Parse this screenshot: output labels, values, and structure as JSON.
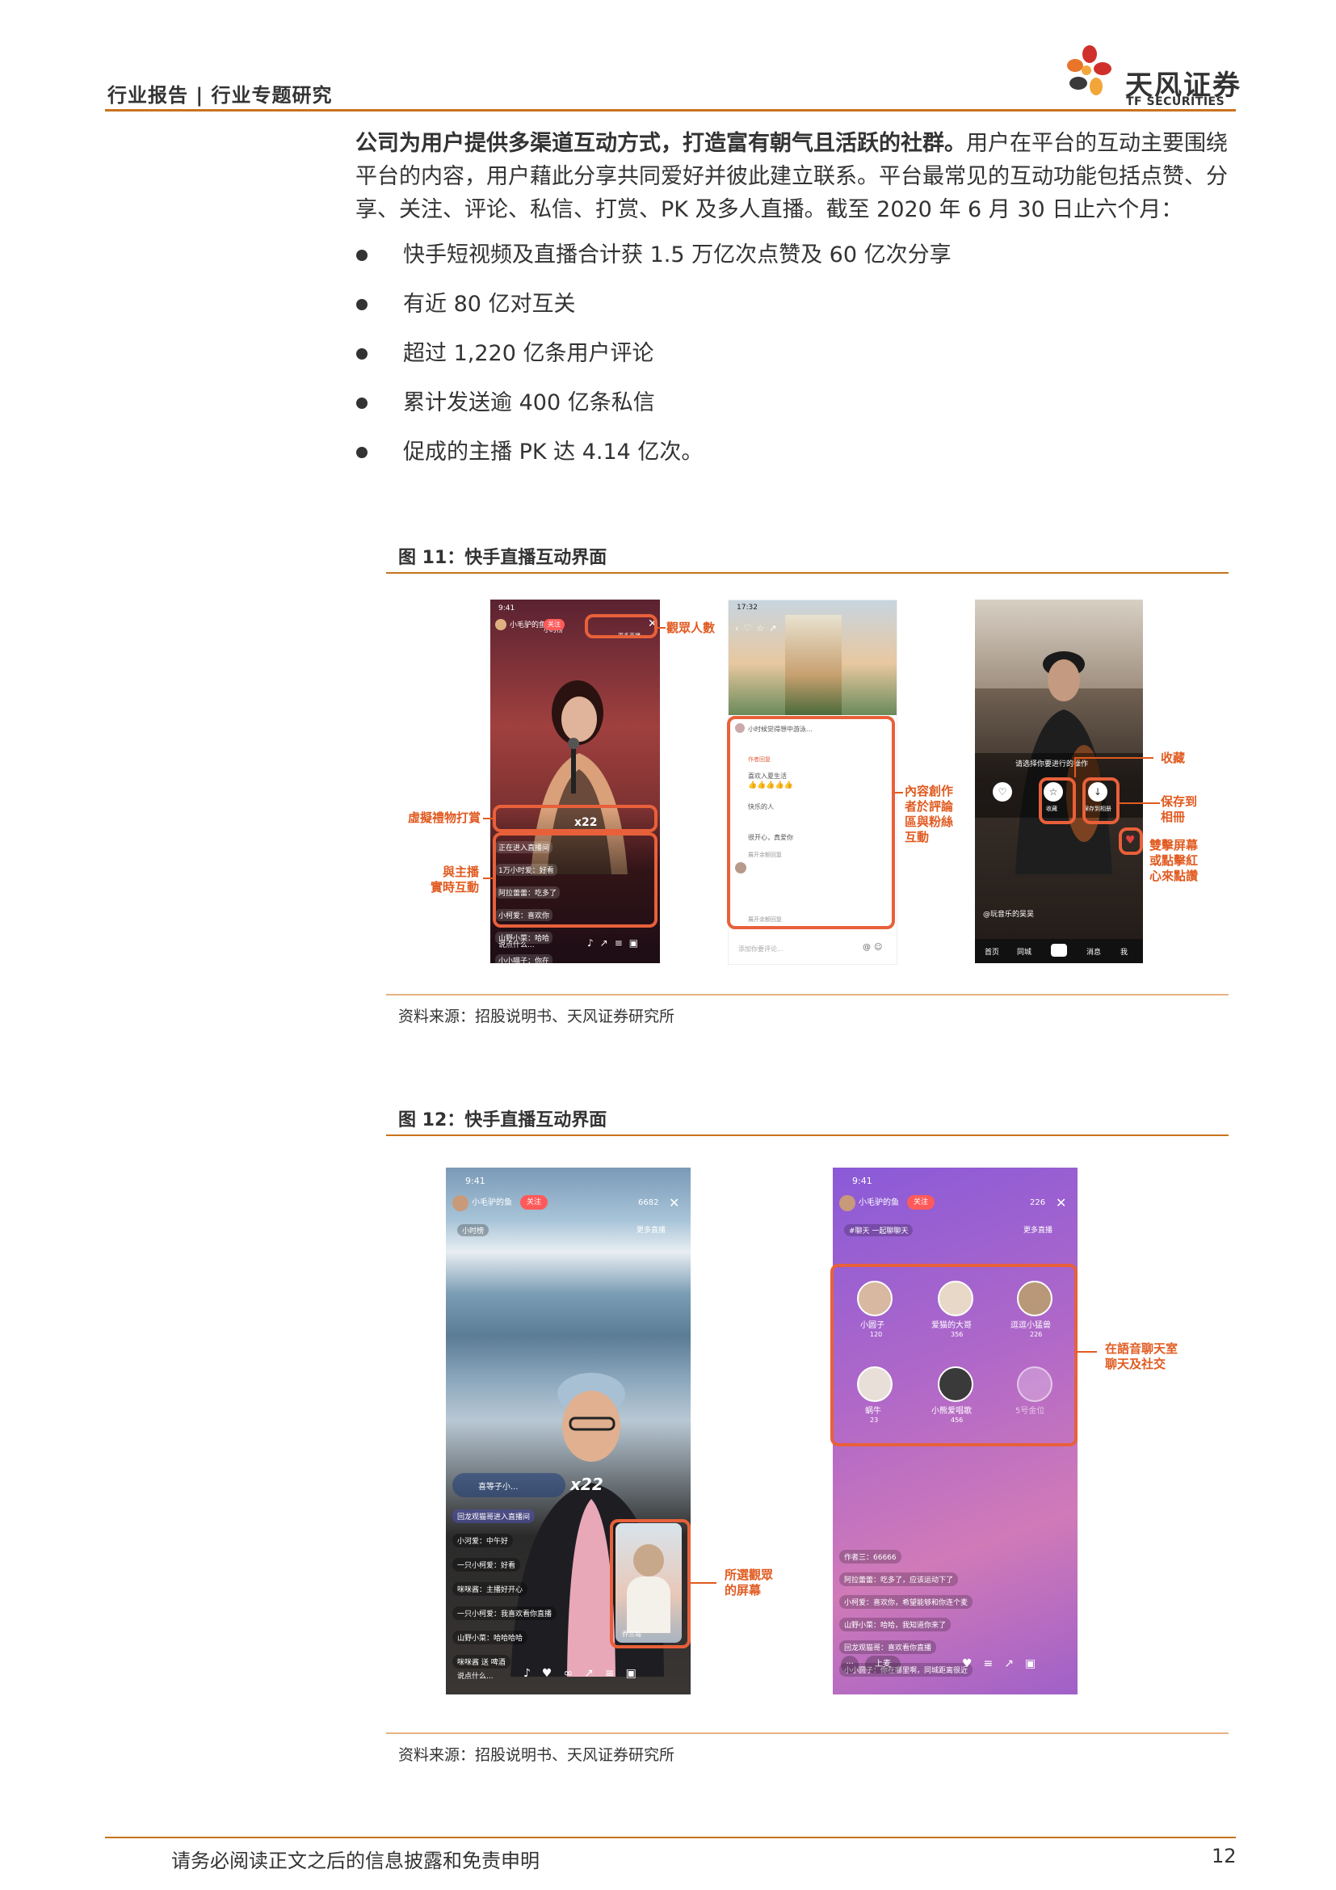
{
  "header": {
    "title": "行业报告 | 行业专题研究",
    "logo_cn": "天风证券",
    "logo_en": "TF SECURITIES"
  },
  "body": {
    "paragraph_bold": "公司为用户提供多渠道互动方式，打造富有朝气且活跃的社群。",
    "paragraph_rest": "用户在平台的互动主要围绕平台的内容，用户藉此分享共同爱好并彼此建立联系。平台最常见的互动功能包括点赞、分享、关注、评论、私信、打赏、PK 及多人直播。截至 2020 年 6 月 30 日止六个月：",
    "bullets": [
      "快手短视频及直播合计获 1.5 万亿次点赞及 60 亿次分享",
      "有近 80 亿对互关",
      "超过 1,220 亿条用户评论",
      "累计发送逾 400 亿条私信",
      "促成的主播 PK 达 4.14 亿次。"
    ]
  },
  "figure11": {
    "title": "图 11：快手直播互动界面",
    "source": "资料来源：招股说明书、天风证券研究所",
    "annotations": {
      "viewers": "觀眾人數",
      "virtual_gift": "虛擬禮物打賞",
      "host_interaction_1": "與主播",
      "host_interaction_2": "實時互動",
      "creator_1": "內容創作",
      "creator_2": "者於評論",
      "creator_3": "區與粉絲",
      "creator_4": "互動",
      "favorite": "收藏",
      "save_1": "保存到",
      "save_2": "相冊",
      "dbl_1": "雙擊屏幕",
      "dbl_2": "或點擊紅",
      "dbl_3": "心來點讚"
    },
    "phone1": {
      "time": "9:41",
      "user": "小毛驴的鱼",
      "follow": "关注",
      "tag": "小时榜",
      "more": "更多直播",
      "gift_count": "x22",
      "input_hint": "说点什么...",
      "messages": [
        "正在进入直播间",
        "1万小时爱：好看",
        "阿拉蕾蕾：吃多了",
        "小柯爱：喜欢你",
        "山野小菜：哈哈",
        "小小喵子：你在"
      ]
    },
    "phone2": {
      "time": "17:32",
      "comments": [
        "小时候觉得想中游泳...",
        "喜欢入夏生活",
        "快乐的人",
        "很开心，真爱你"
      ],
      "reply": "作者回复",
      "expand": "展开余额回复",
      "input_hint": "添加你要评论..."
    },
    "phone3": {
      "prompt": "请选择你要进行的操作",
      "favorite_btn": "收藏",
      "save_btn": "保存到相册",
      "caption": "@玩音乐的吴吴",
      "tabs": [
        "首页",
        "同城",
        "消息",
        "我"
      ]
    }
  },
  "figure12": {
    "title": "图 12：快手直播互动界面",
    "source": "资料来源：招股说明书、天风证券研究所",
    "annotations": {
      "selected_1": "所選觀眾",
      "selected_2": "的屏幕",
      "voice_1": "在語音聊天室",
      "voice_2": "聊天及社交"
    },
    "phone1": {
      "time": "9:41",
      "user": "小毛驴的鱼",
      "follow": "关注",
      "viewers": "6682",
      "tag": "小时榜",
      "more": "更多直播",
      "gift_user": "喜等子小...",
      "gift_count": "x22",
      "pip_name": "乔三岛",
      "input_hint": "说点什么...",
      "messages": [
        "回龙观猫哥进入直播间",
        "小河爱：中午好",
        "一只小柯爱：好看",
        "咪咪酱：主播好开心",
        "一只小柯爱：我喜欢看你直播",
        "山野小菜：哈哈哈哈",
        "咪咪酱 送 啤酒"
      ]
    },
    "phone2": {
      "time": "9:41",
      "user": "小毛驴的鱼",
      "follow": "关注",
      "viewers": "226",
      "tag": "#聊天 一起聊聊天",
      "more": "更多直播",
      "seats": [
        {
          "name": "小圆子",
          "score": "120"
        },
        {
          "name": "爱猫的大哥",
          "score": "356"
        },
        {
          "name": "逗逗小猛兽",
          "score": "226"
        },
        {
          "name": "蜗牛",
          "score": "23"
        },
        {
          "name": "小熊爱唱歌",
          "score": "456"
        },
        {
          "name": "5号金位",
          "score": ""
        }
      ],
      "messages": [
        "作者三：66666",
        "阿拉蕾蕾：吃多了，应该运动下了",
        "小柯爱：喜欢你，希望能够和你连个麦",
        "山野小菜：哈哈，我知道你来了",
        "回龙观猫哥：喜欢看你直播",
        "小小圆子：你在哪里啊，同城距离很近"
      ],
      "input_hint": "上麦"
    }
  },
  "footer": {
    "disclaimer": "请务必阅读正文之后的信息披露和免责申明",
    "page": "12"
  },
  "colors": {
    "accent": "#c8731e",
    "annotation": "#e15a20"
  }
}
